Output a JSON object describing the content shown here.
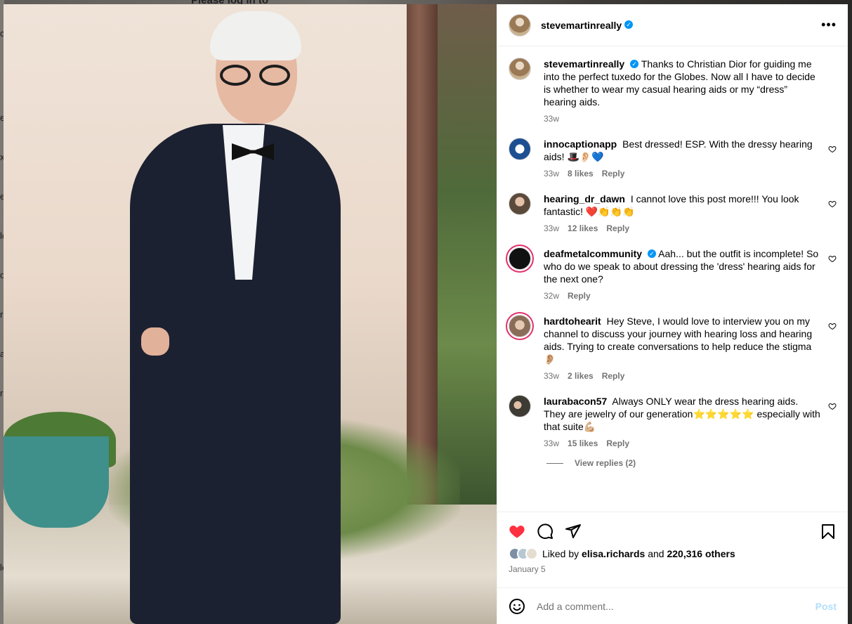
{
  "background": {
    "title": "Please log in to",
    "side_letters": [
      "c",
      "e",
      "x",
      "e",
      "le",
      "o",
      "r",
      "a",
      "r",
      "le"
    ]
  },
  "post": {
    "author": {
      "username": "stevemartinreally",
      "verified": true
    },
    "caption": {
      "username": "stevemartinreally",
      "text": "Thanks to Christian Dior for guiding me into the perfect tuxedo for the Globes. Now all I have to decide is whether to wear my casual hearing aids or my “dress” hearing aids.",
      "time": "33w"
    },
    "comments": [
      {
        "username": "innocaptionapp",
        "text": "Best dressed! ESP. With the dressy hearing aids! 🎩👂🏻💙",
        "time": "33w",
        "likes": "8 likes",
        "reply": "Reply",
        "avatar_color": "#1d4f91"
      },
      {
        "username": "hearing_dr_dawn",
        "text": "I cannot love this post more!!! You look fantastic! ❤️👏👏👏",
        "time": "33w",
        "likes": "12 likes",
        "reply": "Reply",
        "avatar_color": "#6b5a4a"
      },
      {
        "username": "deafmetalcommunity",
        "verified": true,
        "text": "Aah... but the outfit is incomplete! So who do we speak to about dressing the 'dress' hearing aids for the next one?",
        "time": "32w",
        "likes": "",
        "reply": "Reply",
        "avatar_color": "#111111"
      },
      {
        "username": "hardtohearit",
        "text": "Hey Steve, I would love to interview you on my channel to discuss your journey with hearing loss and hearing aids. Trying to create conversations to help reduce the stigma👂🏼",
        "time": "33w",
        "likes": "2 likes",
        "reply": "Reply",
        "avatar_color": "#d9c8b8"
      },
      {
        "username": "laurabacon57",
        "text": "Always ONLY wear the dress hearing aids. They are jewelry of our generation⭐️⭐️⭐️⭐️⭐️ especially with that suite💪🏼",
        "time": "33w",
        "likes": "15 likes",
        "reply": "Reply",
        "avatar_color": "#4a4a44"
      }
    ],
    "view_replies": "View replies (2)",
    "liked_by": {
      "prefix": "Liked by",
      "user": "elisa.richards",
      "and": "and",
      "others": "220,316 others"
    },
    "date": "January 5",
    "add_comment_placeholder": "Add a comment...",
    "post_button": "Post"
  },
  "colors": {
    "like_red": "#ff3040",
    "verified_blue": "#0095f6",
    "post_button": "#b2dffc",
    "meta_gray": "#737373"
  },
  "icons": {
    "like": "heart-filled-icon",
    "comment": "speech-bubble-icon",
    "share": "paper-plane-icon",
    "save": "bookmark-icon",
    "emoji": "smiley-icon",
    "more": "ellipsis-icon"
  }
}
